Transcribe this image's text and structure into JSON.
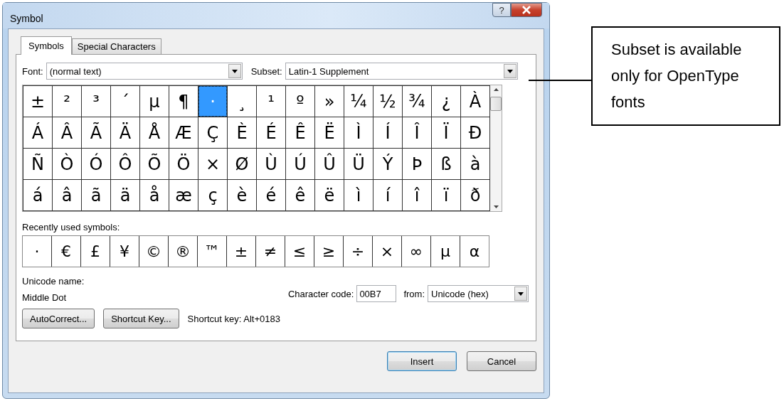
{
  "window": {
    "title": "Symbol",
    "help_button": "?"
  },
  "tabs": [
    {
      "label": "Symbols",
      "selected": true
    },
    {
      "label": "Special Characters",
      "selected": false
    }
  ],
  "font": {
    "label": "Font:",
    "value": "(normal text)"
  },
  "subset": {
    "label": "Subset:",
    "value": "Latin-1 Supplement"
  },
  "symbol_grid": {
    "rows": [
      [
        {
          "char": "±",
          "selected": false
        },
        {
          "char": "²",
          "selected": false
        },
        {
          "char": "³",
          "selected": false
        },
        {
          "char": "´",
          "selected": false
        },
        {
          "char": "µ",
          "selected": false
        },
        {
          "char": "¶",
          "selected": false
        },
        {
          "char": "·",
          "selected": true
        },
        {
          "char": "¸",
          "selected": false
        },
        {
          "char": "¹",
          "selected": false
        },
        {
          "char": "º",
          "selected": false
        },
        {
          "char": "»",
          "selected": false
        },
        {
          "char": "¼",
          "selected": false
        },
        {
          "char": "½",
          "selected": false
        },
        {
          "char": "¾",
          "selected": false
        },
        {
          "char": "¿",
          "selected": false
        },
        {
          "char": "À",
          "selected": false
        }
      ],
      [
        {
          "char": "Á",
          "selected": false
        },
        {
          "char": "Â",
          "selected": false
        },
        {
          "char": "Ã",
          "selected": false
        },
        {
          "char": "Ä",
          "selected": false
        },
        {
          "char": "Å",
          "selected": false
        },
        {
          "char": "Æ",
          "selected": false
        },
        {
          "char": "Ç",
          "selected": false
        },
        {
          "char": "È",
          "selected": false
        },
        {
          "char": "É",
          "selected": false
        },
        {
          "char": "Ê",
          "selected": false
        },
        {
          "char": "Ë",
          "selected": false
        },
        {
          "char": "Ì",
          "selected": false
        },
        {
          "char": "Í",
          "selected": false
        },
        {
          "char": "Î",
          "selected": false
        },
        {
          "char": "Ï",
          "selected": false
        },
        {
          "char": "Ð",
          "selected": false
        }
      ],
      [
        {
          "char": "Ñ",
          "selected": false
        },
        {
          "char": "Ò",
          "selected": false
        },
        {
          "char": "Ó",
          "selected": false
        },
        {
          "char": "Ô",
          "selected": false
        },
        {
          "char": "Õ",
          "selected": false
        },
        {
          "char": "Ö",
          "selected": false
        },
        {
          "char": "×",
          "selected": false
        },
        {
          "char": "Ø",
          "selected": false
        },
        {
          "char": "Ù",
          "selected": false
        },
        {
          "char": "Ú",
          "selected": false
        },
        {
          "char": "Û",
          "selected": false
        },
        {
          "char": "Ü",
          "selected": false
        },
        {
          "char": "Ý",
          "selected": false
        },
        {
          "char": "Þ",
          "selected": false
        },
        {
          "char": "ß",
          "selected": false
        },
        {
          "char": "à",
          "selected": false
        }
      ],
      [
        {
          "char": "á",
          "selected": false
        },
        {
          "char": "â",
          "selected": false
        },
        {
          "char": "ã",
          "selected": false
        },
        {
          "char": "ä",
          "selected": false
        },
        {
          "char": "å",
          "selected": false
        },
        {
          "char": "æ",
          "selected": false
        },
        {
          "char": "ç",
          "selected": false
        },
        {
          "char": "è",
          "selected": false
        },
        {
          "char": "é",
          "selected": false
        },
        {
          "char": "ê",
          "selected": false
        },
        {
          "char": "ë",
          "selected": false
        },
        {
          "char": "ì",
          "selected": false
        },
        {
          "char": "í",
          "selected": false
        },
        {
          "char": "î",
          "selected": false
        },
        {
          "char": "ï",
          "selected": false
        },
        {
          "char": "ð",
          "selected": false
        }
      ]
    ]
  },
  "recent": {
    "label": "Recently used symbols:",
    "symbols": [
      "·",
      "€",
      "£",
      "¥",
      "©",
      "®",
      "™",
      "±",
      "≠",
      "≤",
      "≥",
      "÷",
      "×",
      "∞",
      "µ",
      "α"
    ]
  },
  "unicode_name": {
    "label": "Unicode name:",
    "value": "Middle Dot"
  },
  "character_code": {
    "label": "Character code:",
    "value": "00B7"
  },
  "from": {
    "label": "from:",
    "value": "Unicode (hex)"
  },
  "action_buttons": [
    "AutoCorrect...",
    "Shortcut Key..."
  ],
  "shortcut_key": "Shortcut key: Alt+0183",
  "footer_buttons": [
    {
      "label": "Insert",
      "default": true
    },
    {
      "label": "Cancel",
      "default": false
    }
  ],
  "callout": {
    "text": "Subset is available only for OpenType fonts"
  }
}
